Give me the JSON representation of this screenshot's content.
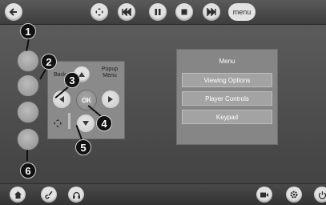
{
  "top_bar": {
    "back_icon": "back-arrow-icon",
    "dpad_icon": "dpad-icon",
    "previous_icon": "skip-previous-icon",
    "pause_icon": "pause-icon",
    "stop_icon": "stop-icon",
    "next_icon": "skip-next-icon",
    "menu_label": "menu"
  },
  "remote_pad": {
    "back_label": "Back",
    "popup_menu_label": "Popup\nMenu",
    "ok_label": "OK"
  },
  "menu_panel": {
    "title": "Menu",
    "items": [
      {
        "label": "Viewing Options"
      },
      {
        "label": "Player Controls"
      },
      {
        "label": "Keypad"
      }
    ]
  },
  "callouts": [
    "1",
    "2",
    "3",
    "4",
    "5",
    "6"
  ],
  "bottom_bar": {
    "icons": [
      "home-icon",
      "guitar-icon",
      "headphones-icon",
      "camera-icon",
      "gear-icon",
      "power-icon"
    ]
  },
  "colors": {
    "background": "#4a4a4a",
    "button_face": "#e2e2e2",
    "panel": "#868686",
    "menu_item": "#a3a3a3",
    "callout": "#111111"
  }
}
